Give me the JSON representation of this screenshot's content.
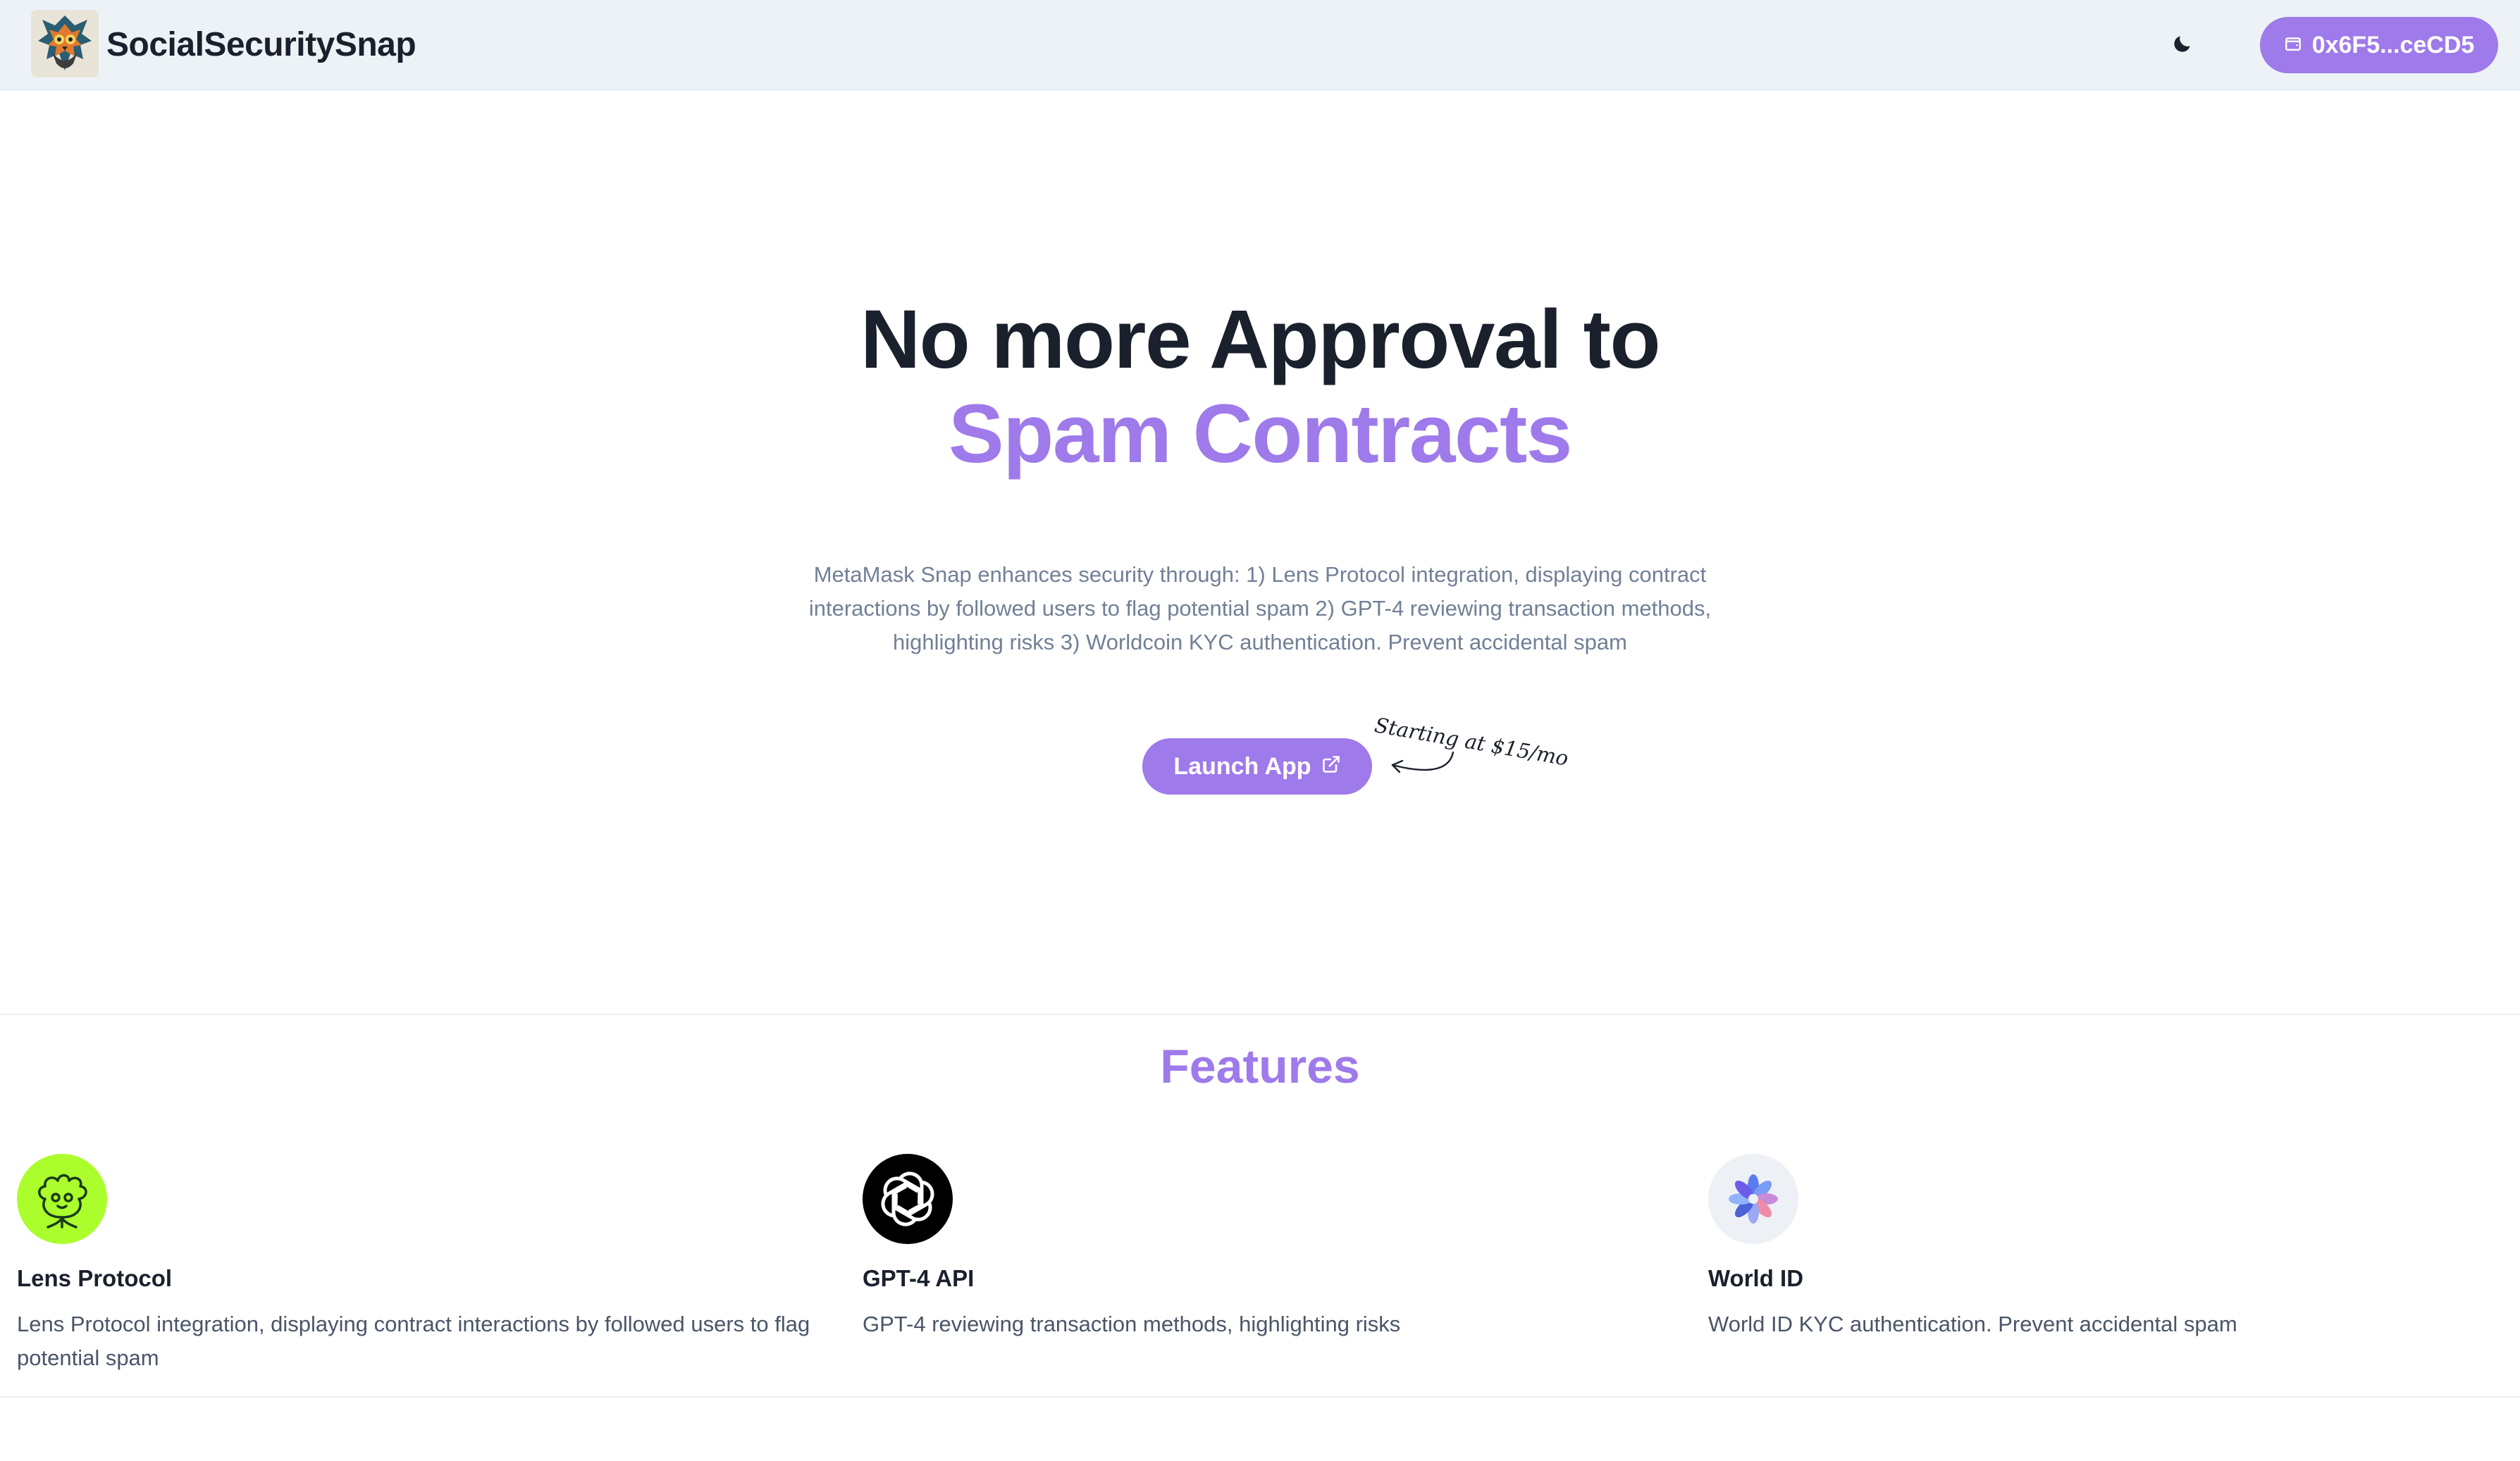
{
  "header": {
    "brand": "SocialSecuritySnap",
    "logo_icon": "owl-shield-logo-icon",
    "theme_icon": "moon-icon",
    "wallet_icon": "wallet-icon",
    "wallet_address": "0x6F5...ceCD5"
  },
  "hero": {
    "title_line1": "No more Approval to",
    "title_line2": "Spam Contracts",
    "description": "MetaMask Snap enhances security through: 1) Lens Protocol integration, displaying contract interactions by followed users to flag potential spam 2) GPT-4 reviewing transaction methods, highlighting risks 3) Worldcoin KYC authentication. Prevent accidental spam",
    "launch_label": "Launch App",
    "launch_icon": "external-link-icon",
    "pricing_note": "Starting at $15/mo"
  },
  "features": {
    "title": "Features",
    "items": [
      {
        "title": "Lens Protocol",
        "description": "Lens Protocol integration, displaying contract interactions by followed users to flag potential spam",
        "icon": "lens-protocol-icon"
      },
      {
        "title": "GPT-4 API",
        "description": "GPT-4 reviewing transaction methods, highlighting risks",
        "icon": "openai-icon"
      },
      {
        "title": "World ID",
        "description": "World ID KYC authentication. Prevent accidental spam",
        "icon": "world-id-icon"
      }
    ]
  },
  "colors": {
    "accent": "#9f7aea",
    "header_bg": "#edf2f7",
    "text_dark": "#1a202c",
    "text_muted": "#718096",
    "lens_green": "#abfe2c",
    "openai_black": "#000000"
  }
}
